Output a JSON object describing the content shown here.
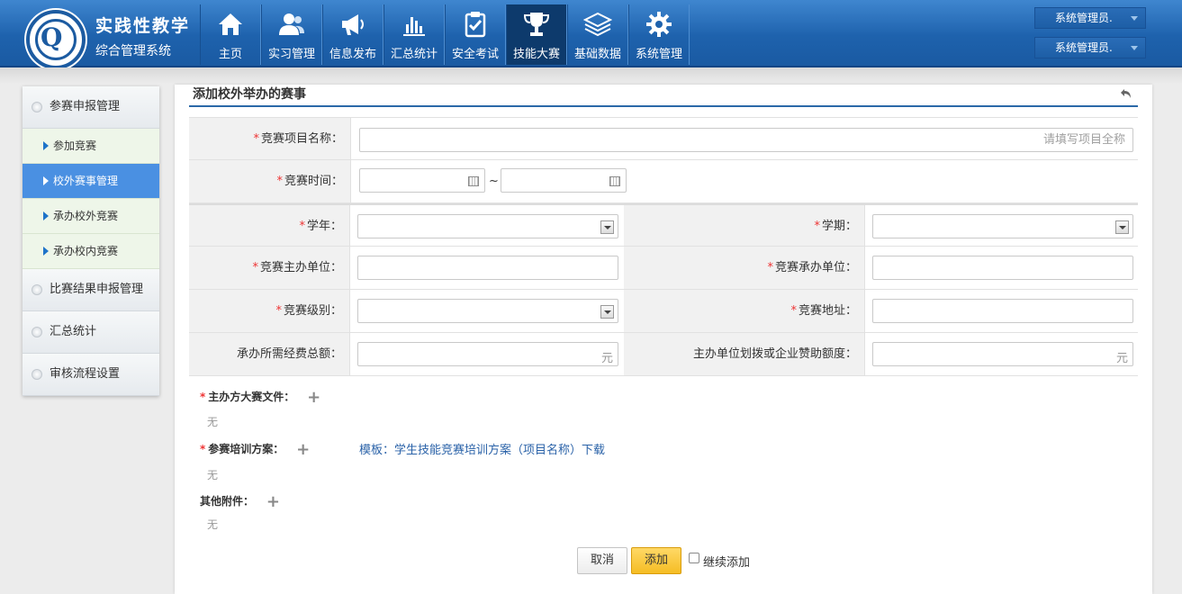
{
  "header": {
    "system_name": "实践性教学",
    "system_subtitle": "综合管理系统",
    "nav": [
      {
        "label": "主页",
        "icon": "home-icon"
      },
      {
        "label": "实习管理",
        "icon": "users-icon"
      },
      {
        "label": "信息发布",
        "icon": "megaphone-icon"
      },
      {
        "label": "汇总统计",
        "icon": "bar-chart-icon"
      },
      {
        "label": "安全考试",
        "icon": "clipboard-check-icon"
      },
      {
        "label": "技能大赛",
        "icon": "trophy-icon",
        "active": true
      },
      {
        "label": "基础数据",
        "icon": "layers-icon"
      },
      {
        "label": "系统管理",
        "icon": "gear-icon"
      }
    ],
    "user_top": "系统管理员.",
    "user_bottom": "系统管理员."
  },
  "sidebar": {
    "groups": [
      {
        "label": "参赛申报管理"
      },
      {
        "label": "比赛结果申报管理"
      },
      {
        "label": "汇总统计"
      },
      {
        "label": "审核流程设置"
      }
    ],
    "subitems": [
      {
        "label": "参加竞赛"
      },
      {
        "label": "校外赛事管理",
        "active": true
      },
      {
        "label": "承办校外竞赛"
      },
      {
        "label": "承办校内竞赛"
      }
    ]
  },
  "page": {
    "title": "添加校外举办的赛事"
  },
  "form": {
    "required_mark": "*",
    "name_label": "竞赛项目名称：",
    "name_placeholder": "请填写项目全称",
    "time_label": "竞赛时间：",
    "time_sep": "~",
    "year_label": "学年：",
    "term_label": "学期：",
    "host_label": "竞赛主办单位：",
    "undertake_label": "竞赛承办单位：",
    "level_label": "竞赛级别：",
    "address_label": "竞赛地址：",
    "budget_label": "承办所需经费总额：",
    "sponsor_label": "主办单位划拨或企业赞助额度：",
    "unit": "元"
  },
  "attachments": {
    "host_files_label": "主办方大赛文件：",
    "training_plan_label": "参赛培训方案：",
    "other_label": "其他附件：",
    "none_text": "无",
    "template_link": "模板：学生技能竞赛培训方案（项目名称）下载"
  },
  "actions": {
    "cancel": "取消",
    "add": "添加",
    "continue_add": "继续添加"
  },
  "colors": {
    "header_blue": "#1e62ad",
    "active_nav": "#0d3a6c",
    "active_sidebar": "#4a90e2",
    "required": "#ee3333",
    "add_button": "#f5bd24",
    "link": "#2a62a8"
  }
}
